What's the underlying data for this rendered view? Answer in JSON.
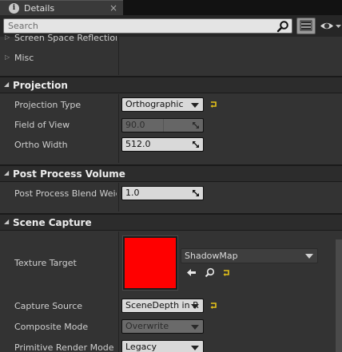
{
  "tab": {
    "title": "Details",
    "icon": "info-icon",
    "close": "×"
  },
  "search": {
    "placeholder": "Search",
    "value": ""
  },
  "toolbar": {
    "grid_icon": "property-matrix-icon",
    "eye_icon": "eye-icon"
  },
  "collapsed_sections": [
    {
      "label": "Screen Space Reflections"
    },
    {
      "label": "Misc"
    }
  ],
  "projection": {
    "title": "Projection",
    "rows": [
      {
        "label": "Projection Type",
        "value": "Orthographic"
      },
      {
        "label": "Field of View",
        "value": "90.0"
      },
      {
        "label": "Ortho Width",
        "value": "512.0"
      }
    ]
  },
  "post_process": {
    "title": "Post Process Volume",
    "rows": [
      {
        "label": "Post Process Blend Weight",
        "value": "1.0"
      }
    ]
  },
  "scene_capture": {
    "title": "Scene Capture",
    "texture_target": {
      "label": "Texture Target",
      "asset": "ShadowMap",
      "swatch_color": "#ff0000"
    },
    "rows": [
      {
        "label": "Capture Source",
        "value": "SceneDepth in R"
      },
      {
        "label": "Composite Mode",
        "value": "Overwrite"
      },
      {
        "label": "Primitive Render Mode",
        "value": "Legacy"
      }
    ]
  },
  "colors": {
    "reset_arrow": "#e6c31a",
    "panel": "#333333",
    "header": "#2c2c2c"
  }
}
